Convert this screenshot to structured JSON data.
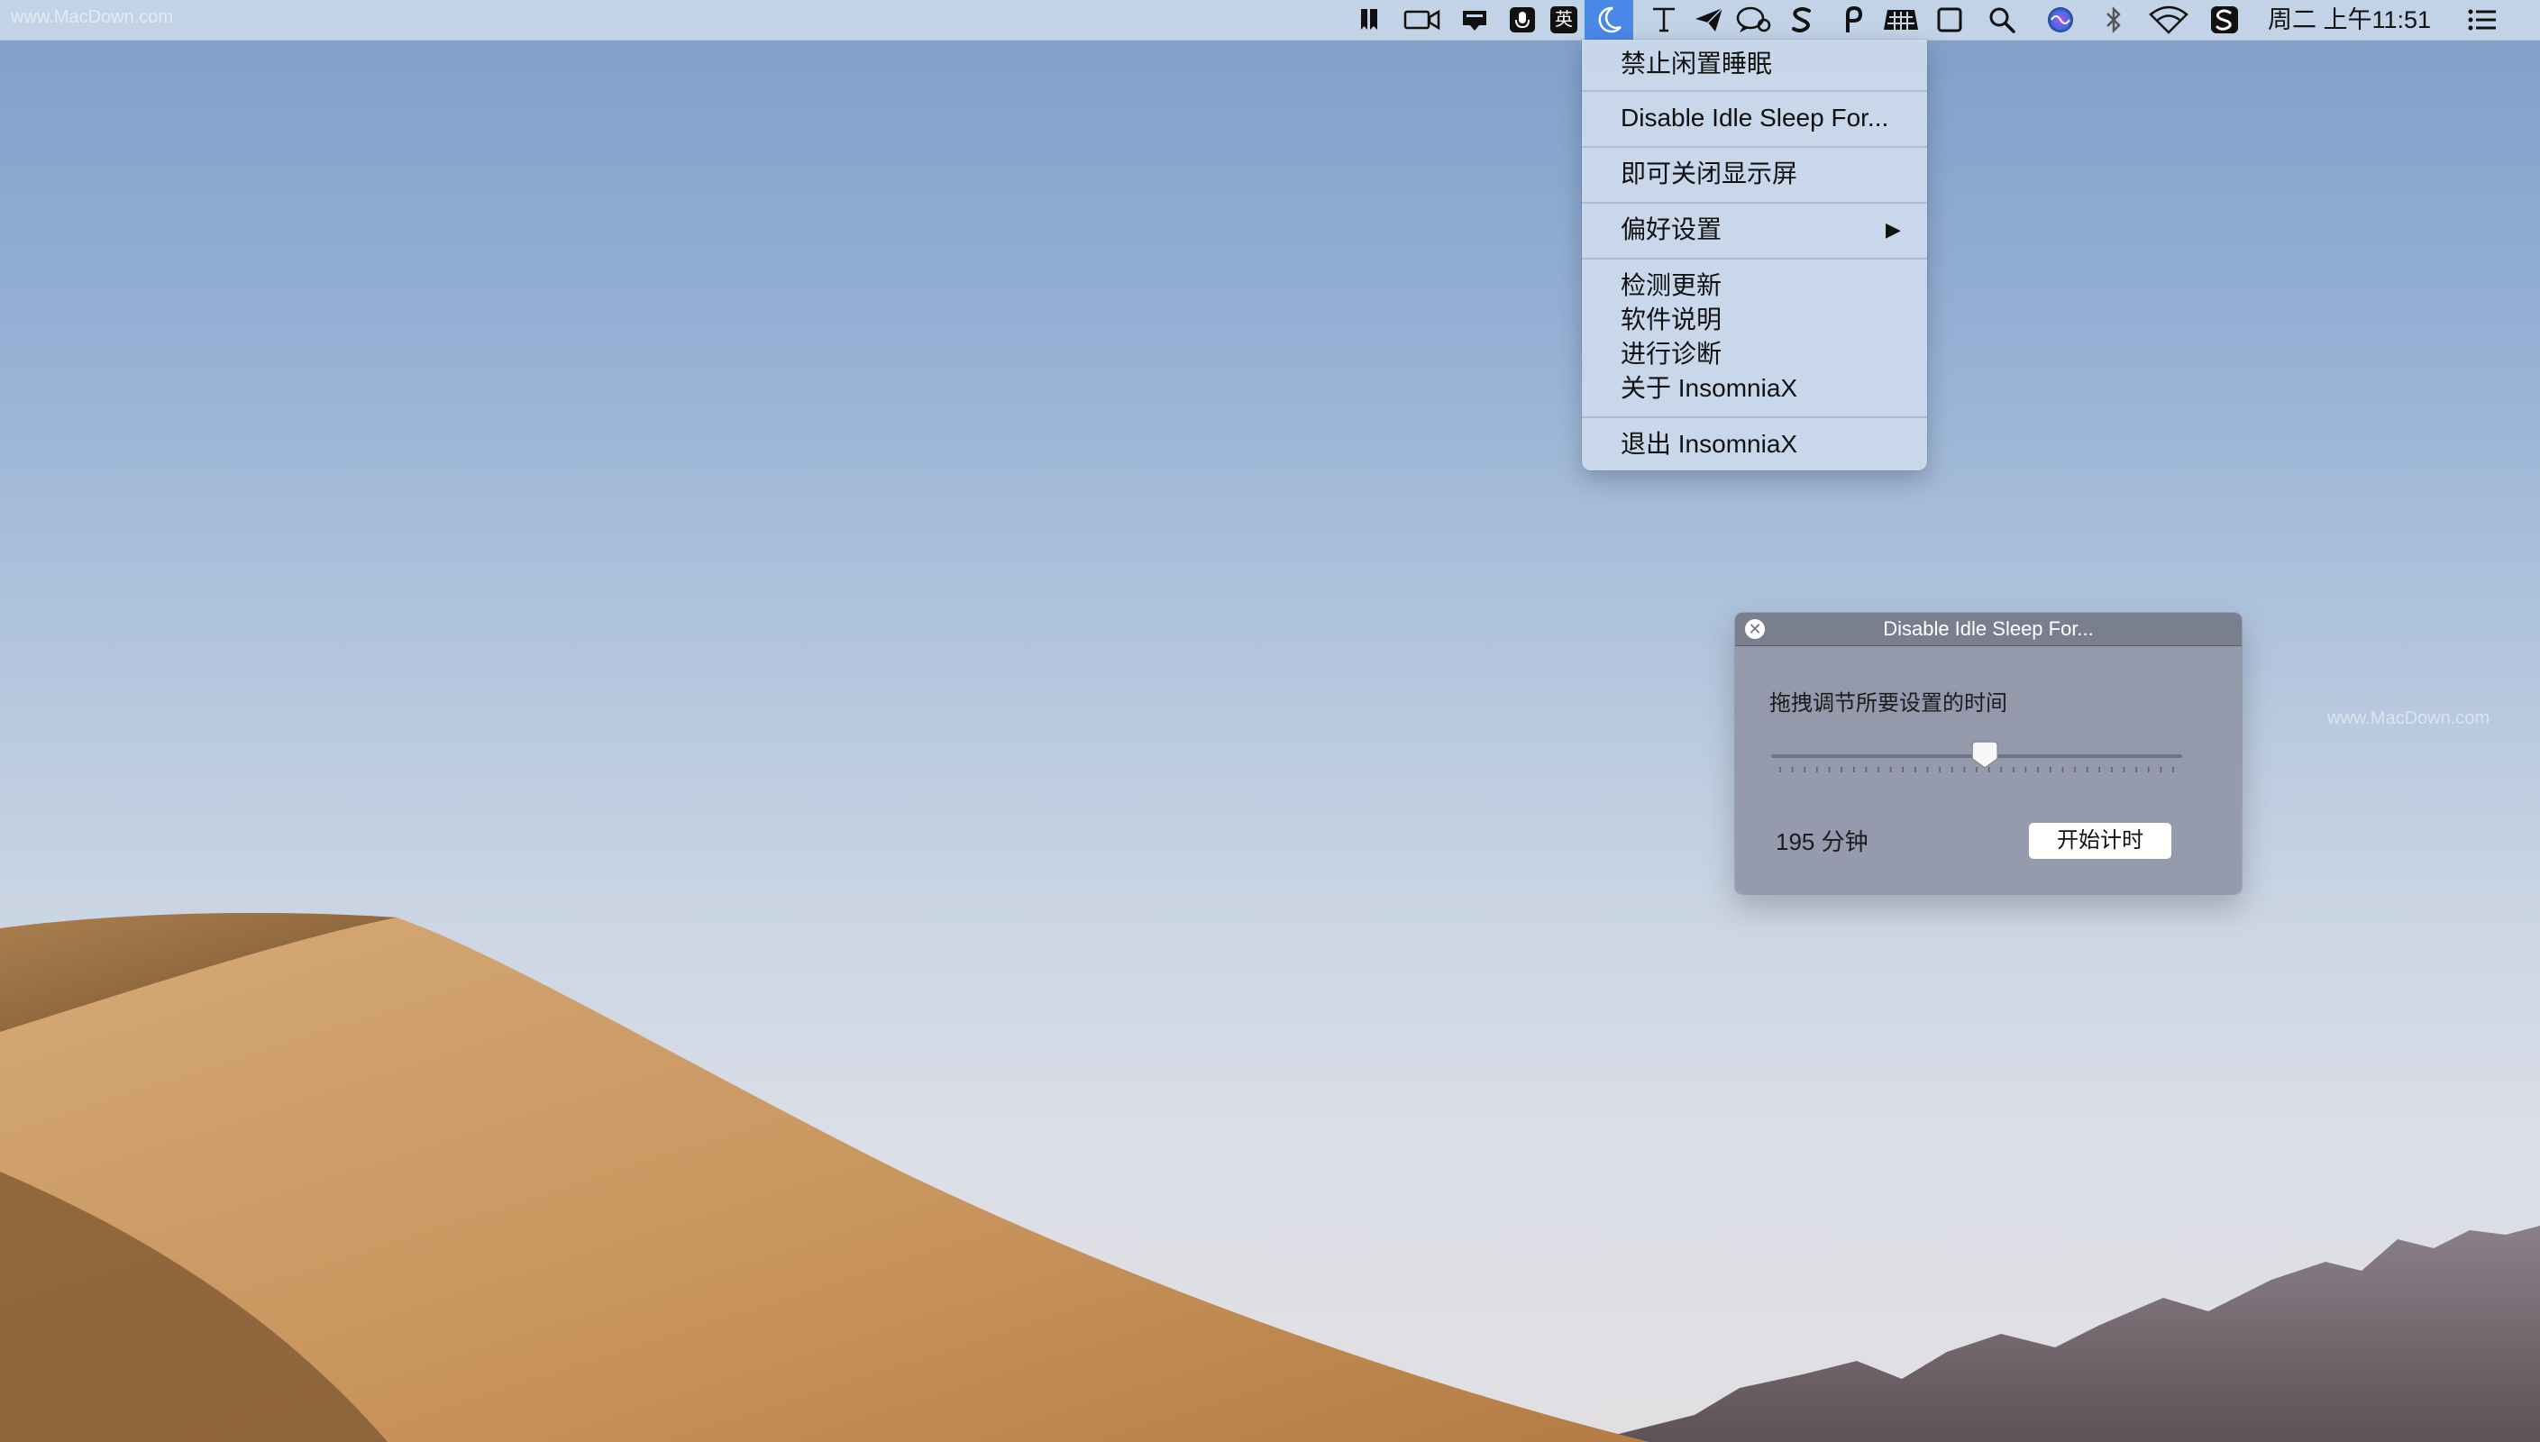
{
  "menubar": {
    "watermark": "www.MacDown.com",
    "clock": "周二 上午11:51",
    "status_icons": [
      "bookmark-icon",
      "video-camera-icon",
      "notification-tray-icon",
      "microphone-icon",
      "input-method-icon",
      "insomniax-moon-icon",
      "text-tool-icon",
      "send-icon",
      "chat-icon",
      "s-app-icon",
      "p-app-icon",
      "keyboard-icon",
      "screenshot-icon",
      "spotlight-search-icon",
      "siri-icon",
      "bluetooth-icon",
      "wifi-icon",
      "sogou-input-icon",
      "notification-center-icon"
    ],
    "input_method_label": "英",
    "active_icon_color": "#4a88e8"
  },
  "menu": {
    "items": [
      {
        "label": "禁止闲置睡眠"
      },
      {
        "label": "Disable Idle Sleep For..."
      },
      {
        "label": "即可关闭显示屏"
      },
      {
        "label": "偏好设置",
        "submenu_arrow": "▶"
      },
      {
        "label": "检测更新"
      },
      {
        "label": "软件说明"
      },
      {
        "label": "进行诊断"
      },
      {
        "label": "关于 InsomniaX"
      },
      {
        "label": "退出 InsomniaX"
      }
    ]
  },
  "panel": {
    "title": "Disable Idle Sleep For...",
    "close_icon": "close-icon",
    "instruction": "拖拽调节所要设置的时间",
    "slider_fraction": 0.52,
    "duration": "195 分钟",
    "start_button": "开始计时"
  },
  "desktop": {
    "watermark": "www.MacDown.com",
    "wallpaper": "desert dune"
  }
}
